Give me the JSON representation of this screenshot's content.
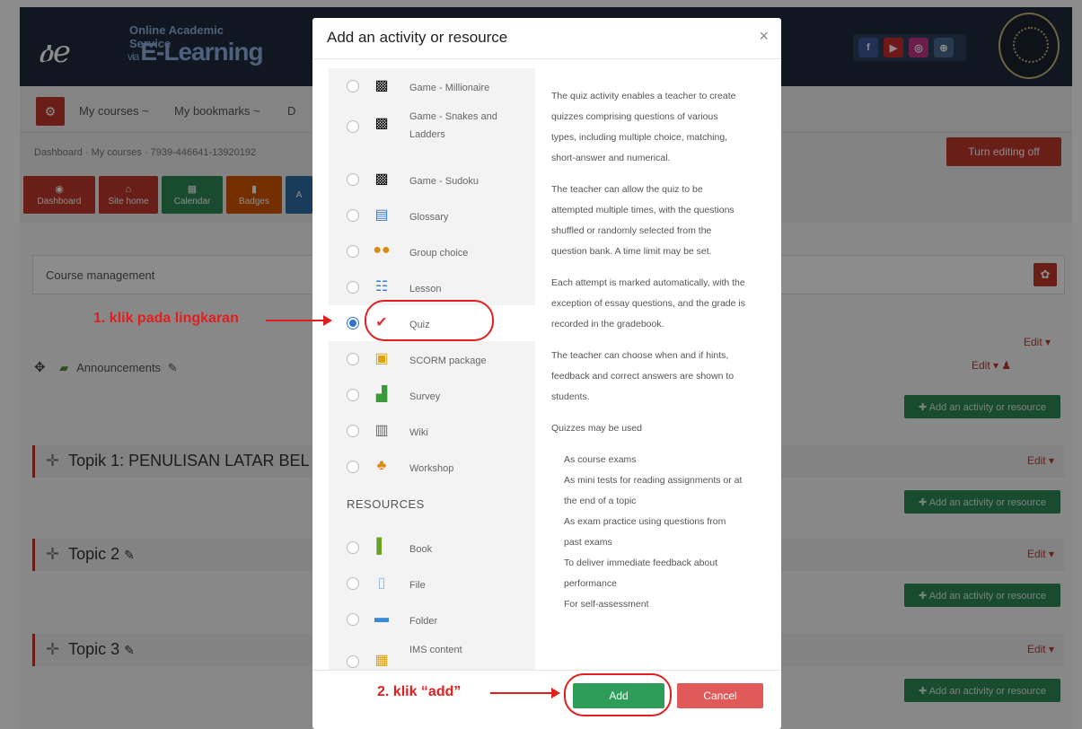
{
  "header": {
    "logo_line1": "Online Academic Service",
    "logo_line2_prefix": "via",
    "logo_line2": "E-Learning",
    "social": [
      {
        "icon": "facebook-icon",
        "glyph": "f",
        "color": "#3b5998"
      },
      {
        "icon": "youtube-icon",
        "glyph": "▶",
        "color": "#cc2a2a"
      },
      {
        "icon": "instagram-icon",
        "glyph": "◎",
        "color": "#c13584"
      },
      {
        "icon": "globe-icon",
        "glyph": "⊕",
        "color": "#4a6a90"
      }
    ]
  },
  "nav": {
    "home_icon": "dashboard-icon",
    "my_courses": "My courses ~",
    "my_bookmarks": "My bookmarks ~",
    "truncated": "D"
  },
  "breadcrumb": "Dashboard · My courses · 7939-446641-13920192",
  "turn_editing_off": "Turn editing off",
  "quicknav": [
    {
      "label": "Dashboard",
      "color": "#c0392b"
    },
    {
      "label": "Site home",
      "color": "#c0392b"
    },
    {
      "label": "Calendar",
      "color": "#2e8b57"
    },
    {
      "label": "Badges",
      "color": "#d35400"
    },
    {
      "label": "A",
      "color": "#2e6da4"
    }
  ],
  "course_management": "Course management",
  "announcements": "Announcements",
  "edit_label": "Edit ▾",
  "add_activity": "✚ Add an activity or resource",
  "sections": [
    {
      "title": "Topik 1: PENULISAN LATAR BEL"
    },
    {
      "title": "Topic 2"
    },
    {
      "title": "Topic 3"
    }
  ],
  "modal": {
    "title": "Add an activity or resource",
    "close": "×",
    "activities": [
      {
        "label": "Game - Millionaire",
        "icon": "game-icon"
      },
      {
        "label": "Game - Snakes and Ladders",
        "icon": "game-icon"
      },
      {
        "label": "Game - Sudoku",
        "icon": "game-icon"
      },
      {
        "label": "Glossary",
        "icon": "glossary-icon"
      },
      {
        "label": "Group choice",
        "icon": "group-choice-icon"
      },
      {
        "label": "Lesson",
        "icon": "lesson-icon"
      },
      {
        "label": "Quiz",
        "icon": "quiz-icon",
        "selected": true
      },
      {
        "label": "SCORM package",
        "icon": "scorm-icon"
      },
      {
        "label": "Survey",
        "icon": "survey-icon"
      },
      {
        "label": "Wiki",
        "icon": "wiki-icon"
      },
      {
        "label": "Workshop",
        "icon": "workshop-icon"
      }
    ],
    "resources_heading": "RESOURCES",
    "resources": [
      {
        "label": "Book",
        "icon": "book-icon"
      },
      {
        "label": "File",
        "icon": "file-icon"
      },
      {
        "label": "Folder",
        "icon": "folder-icon"
      },
      {
        "label": "IMS content",
        "icon": "ims-content-icon"
      }
    ],
    "description": {
      "p1": "The quiz activity enables a teacher to create quizzes comprising questions of various types, including multiple choice, matching, short-answer and numerical.",
      "p2": "The teacher can allow the quiz to be attempted multiple times, with the questions shuffled or randomly selected from the question bank. A time limit may be set.",
      "p3": "Each attempt is marked automatically, with the exception of essay questions, and the grade is recorded in the gradebook.",
      "p4": "The teacher can choose when and if hints, feedback and correct answers are shown to students.",
      "p5": "Quizzes may be used",
      "uses": [
        "As course exams",
        "As mini tests for reading assignments or at the end of a topic",
        "As exam practice using questions from past exams",
        "To deliver immediate feedback about performance",
        "For self-assessment"
      ]
    },
    "add_button": "Add",
    "cancel_button": "Cancel"
  },
  "annotations": {
    "step1": "1. klik pada lingkaran",
    "step2": "2. klik “add”"
  }
}
